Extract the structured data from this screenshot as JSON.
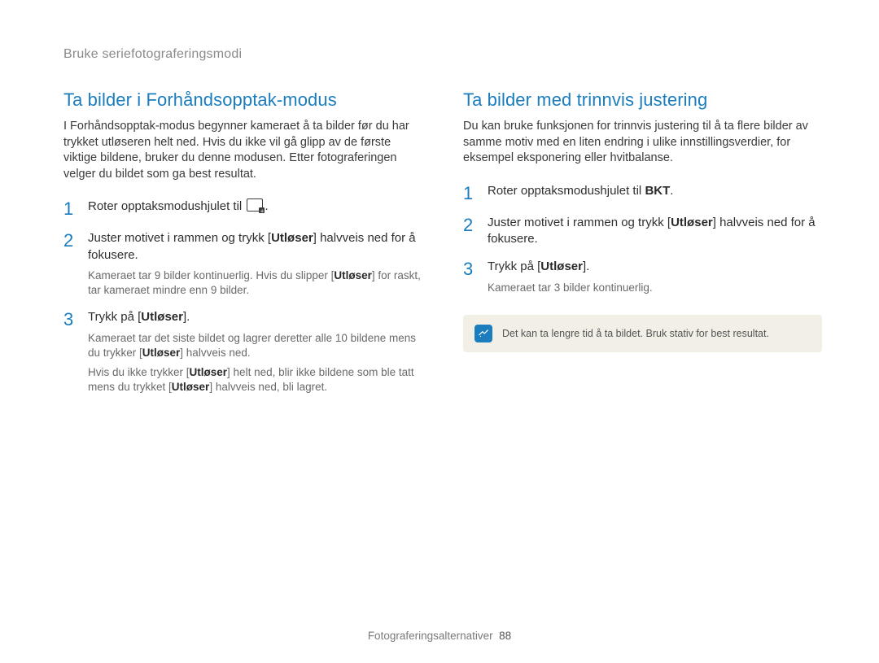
{
  "header": {
    "breadcrumb": "Bruke seriefotograferingsmodi"
  },
  "left": {
    "title": "Ta bilder i Forhåndsopptak-modus",
    "intro": "I Forhåndsopptak-modus begynner kameraet å ta bilder før du har trykket utløseren helt ned. Hvis du ikke vil gå glipp av de første viktige bildene, bruker du denne modusen. Etter fotograferingen velger du bildet som ga best resultat.",
    "step1": {
      "num": "1",
      "text_before": "Roter opptaksmodushjulet til ",
      "text_after": "."
    },
    "step2": {
      "num": "2",
      "text_a": "Juster motivet i rammen og trykk [",
      "bold_a": "Utløser",
      "text_b": "] halvveis ned for å fokusere.",
      "sub_a": "Kameraet tar 9 bilder kontinuerlig. Hvis du slipper [",
      "sub_bold": "Utløser",
      "sub_b": "] for raskt, tar kameraet mindre enn 9 bilder."
    },
    "step3": {
      "num": "3",
      "text_a": "Trykk på [",
      "bold_a": "Utløser",
      "text_b": "].",
      "sub1_a": "Kameraet tar det siste bildet og lagrer deretter alle 10 bildene mens du trykker [",
      "sub1_bold": "Utløser",
      "sub1_b": "] halvveis ned.",
      "sub2_a": "Hvis du ikke trykker [",
      "sub2_bold1": "Utløser",
      "sub2_b": "] helt ned, blir ikke bildene som ble tatt mens du trykket [",
      "sub2_bold2": "Utløser",
      "sub2_c": "] halvveis ned, bli lagret."
    }
  },
  "right": {
    "title": "Ta bilder med trinnvis justering",
    "intro": "Du kan bruke funksjonen for trinnvis justering til å ta flere bilder av samme motiv med en liten endring i ulike innstillingsverdier, for eksempel eksponering eller hvitbalanse.",
    "step1": {
      "num": "1",
      "text_a": "Roter opptaksmodushjulet til ",
      "bold_a": "BKT",
      "text_b": "."
    },
    "step2": {
      "num": "2",
      "text_a": "Juster motivet i rammen og trykk [",
      "bold_a": "Utløser",
      "text_b": "] halvveis ned for å fokusere."
    },
    "step3": {
      "num": "3",
      "text_a": "Trykk på [",
      "bold_a": "Utløser",
      "text_b": "].",
      "sub": "Kameraet tar 3 bilder kontinuerlig."
    },
    "note": "Det kan ta lengre tid å ta bildet. Bruk stativ for best resultat."
  },
  "footer": {
    "section": "Fotograferingsalternativer",
    "page": "88"
  }
}
